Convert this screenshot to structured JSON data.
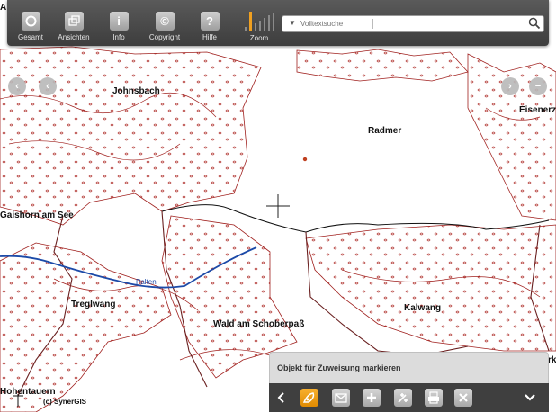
{
  "toolbar": {
    "buttons": [
      {
        "label": "Gesamt",
        "icon": "overview-icon"
      },
      {
        "label": "Ansichten",
        "icon": "views-icon"
      },
      {
        "label": "Info",
        "icon": "info-icon",
        "glyph": "i"
      },
      {
        "label": "Copyright",
        "icon": "copyright-icon",
        "glyph": "©"
      },
      {
        "label": "Hilfe",
        "icon": "help-icon",
        "glyph": "?"
      }
    ],
    "zoom_label": "Zoom",
    "search": {
      "placeholder": "Volltextsuche",
      "value": ""
    }
  },
  "map": {
    "places": [
      "Johnsbach",
      "Eisenerz",
      "Radmer",
      "Gaishorn am See",
      "Treglwang",
      "Kalwang",
      "Wald am Schoberpaß",
      "Hohentauern"
    ],
    "river_label": "Palten",
    "partial_labels": [
      "A",
      "rk"
    ],
    "copyright": "(c) SynerGIS"
  },
  "panel": {
    "title": "Objekt für Zuweisung markieren",
    "buttons": [
      "back-icon",
      "pen-icon",
      "mail-icon",
      "add-icon",
      "edit-icon",
      "print-icon",
      "close-icon",
      "collapse-icon"
    ]
  },
  "colors": {
    "toolbar": "#4a4a4a",
    "accent": "#f0a020",
    "contour": "#a0201e",
    "river": "#1c4aa8"
  }
}
